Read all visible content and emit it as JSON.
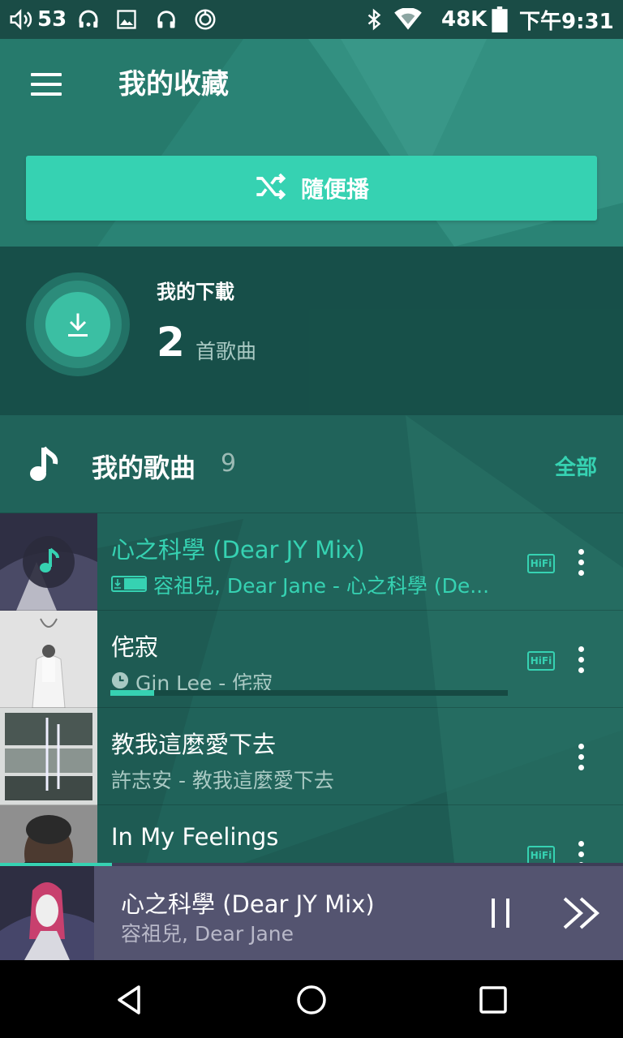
{
  "status_bar": {
    "volume_level": "53",
    "network_speed": "48K",
    "time": "下午9:31",
    "icons": [
      "volume-icon",
      "headset-icon",
      "image-icon",
      "headphones-icon",
      "sync-icon",
      "bluetooth-icon",
      "wifi-icon",
      "battery-icon"
    ]
  },
  "app_bar": {
    "title": "我的收藏"
  },
  "shuffle": {
    "label": "隨便播"
  },
  "downloads": {
    "title": "我的下載",
    "count": "2",
    "unit": "首歌曲"
  },
  "songs_section": {
    "title": "我的歌曲",
    "count": "9",
    "all_label": "全部"
  },
  "songs": [
    {
      "title": "心之科學 (Dear JY Mix)",
      "subtitle": "容祖兒, Dear Jane - 心之科學 (De...",
      "badge": "HiFi",
      "status_icon": "download-hifi-icon",
      "hifi": true,
      "playing": true
    },
    {
      "title": "侘寂",
      "subtitle": "Gin Lee - 侘寂",
      "badge": "HiFi",
      "status_icon": "clock-icon",
      "hifi": true,
      "progress": 0.11
    },
    {
      "title": "教我這麼愛下去",
      "subtitle": "許志安 - 教我這麼愛下去",
      "hifi": false
    },
    {
      "title": "In My Feelings",
      "subtitle": "",
      "badge": "HiFi",
      "hifi": true
    }
  ],
  "player": {
    "title": "心之科學 (Dear JY Mix)",
    "artist": "容祖兒, Dear Jane",
    "progress": 0.18
  },
  "colors": {
    "accent": "#36d2b2",
    "background": "#1d5b53",
    "player_bg": "#545470"
  }
}
